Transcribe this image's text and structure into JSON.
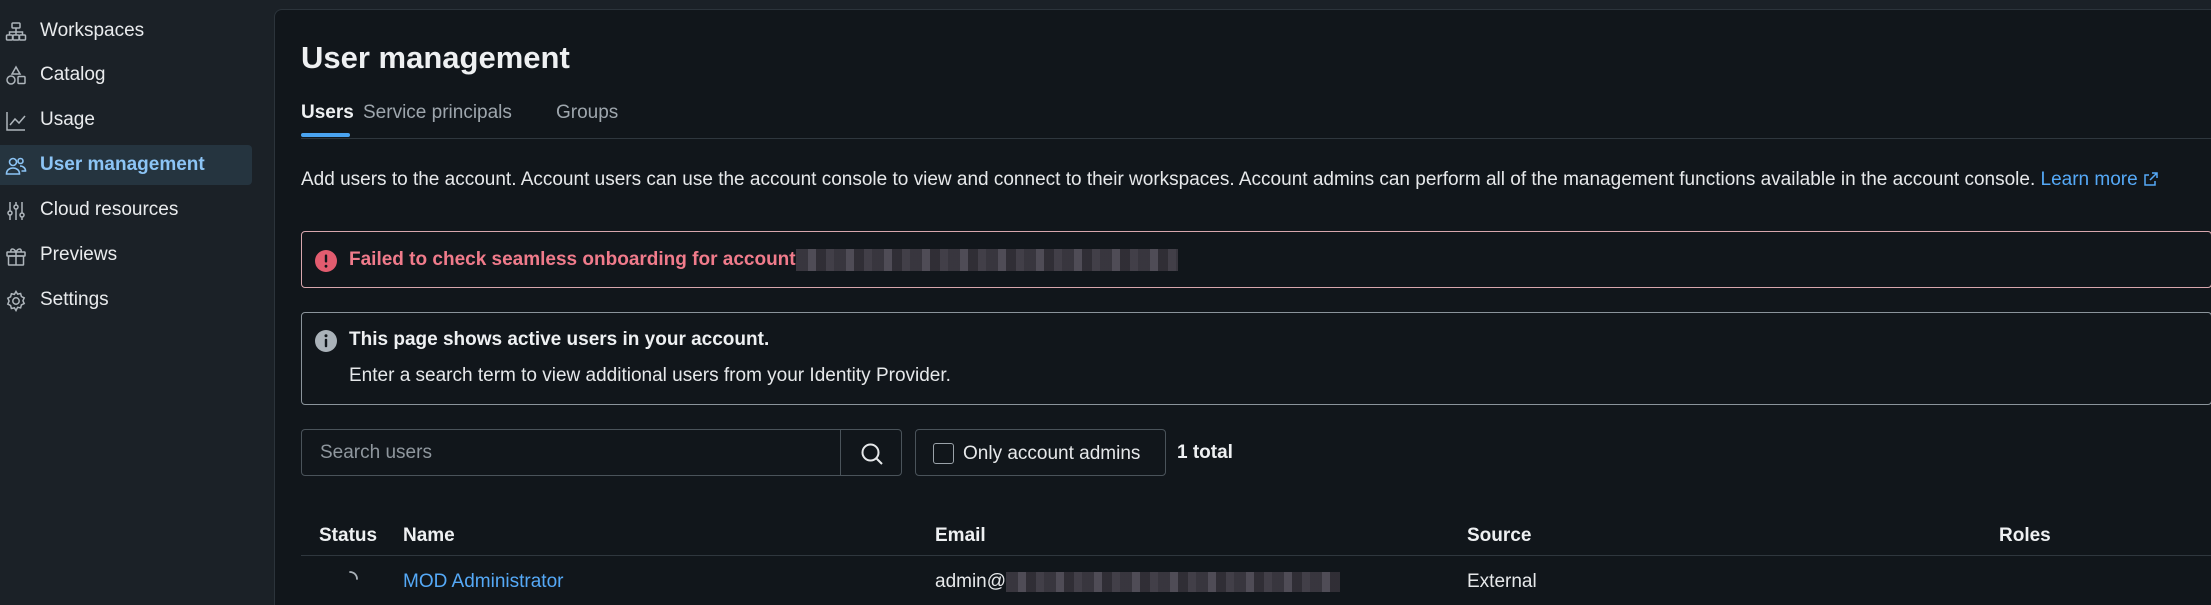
{
  "sidebar": {
    "items": [
      {
        "label": "Workspaces",
        "icon": "workspaces-icon"
      },
      {
        "label": "Catalog",
        "icon": "catalog-icon"
      },
      {
        "label": "Usage",
        "icon": "usage-chart-icon"
      },
      {
        "label": "User management",
        "icon": "users-icon",
        "active": true
      },
      {
        "label": "Cloud resources",
        "icon": "cloud-resources-icon"
      },
      {
        "label": "Previews",
        "icon": "gift-icon"
      },
      {
        "label": "Settings",
        "icon": "gear-icon"
      }
    ]
  },
  "main": {
    "title": "User management",
    "tabs": [
      {
        "label": "Users",
        "active": true
      },
      {
        "label": "Service principals"
      },
      {
        "label": "Groups"
      }
    ],
    "description": "Add users to the account. Account users can use the account console to view and connect to their workspaces. Account admins can perform all of the management functions available in the account console.",
    "learn_more": "Learn more",
    "error_alert": {
      "message": "Failed to check seamless onboarding for account"
    },
    "info_alert": {
      "title": "This page shows active users in your account.",
      "body": "Enter a search term to view additional users from your Identity Provider."
    },
    "search": {
      "placeholder": "Search users"
    },
    "filter": {
      "label": "Only account admins",
      "checked": false
    },
    "total": "1 total",
    "table": {
      "columns": [
        "Status",
        "Name",
        "Email",
        "Source",
        "Roles"
      ],
      "rows": [
        {
          "status": "loading",
          "name": "MOD Administrator",
          "email_prefix": "admin@",
          "source": "External",
          "roles": ""
        }
      ]
    }
  },
  "colors": {
    "accent": "#4aa3f0",
    "link": "#55a9f7",
    "error": "#f07b8b",
    "background": "#11161b",
    "sidebar": "#1b2127"
  }
}
